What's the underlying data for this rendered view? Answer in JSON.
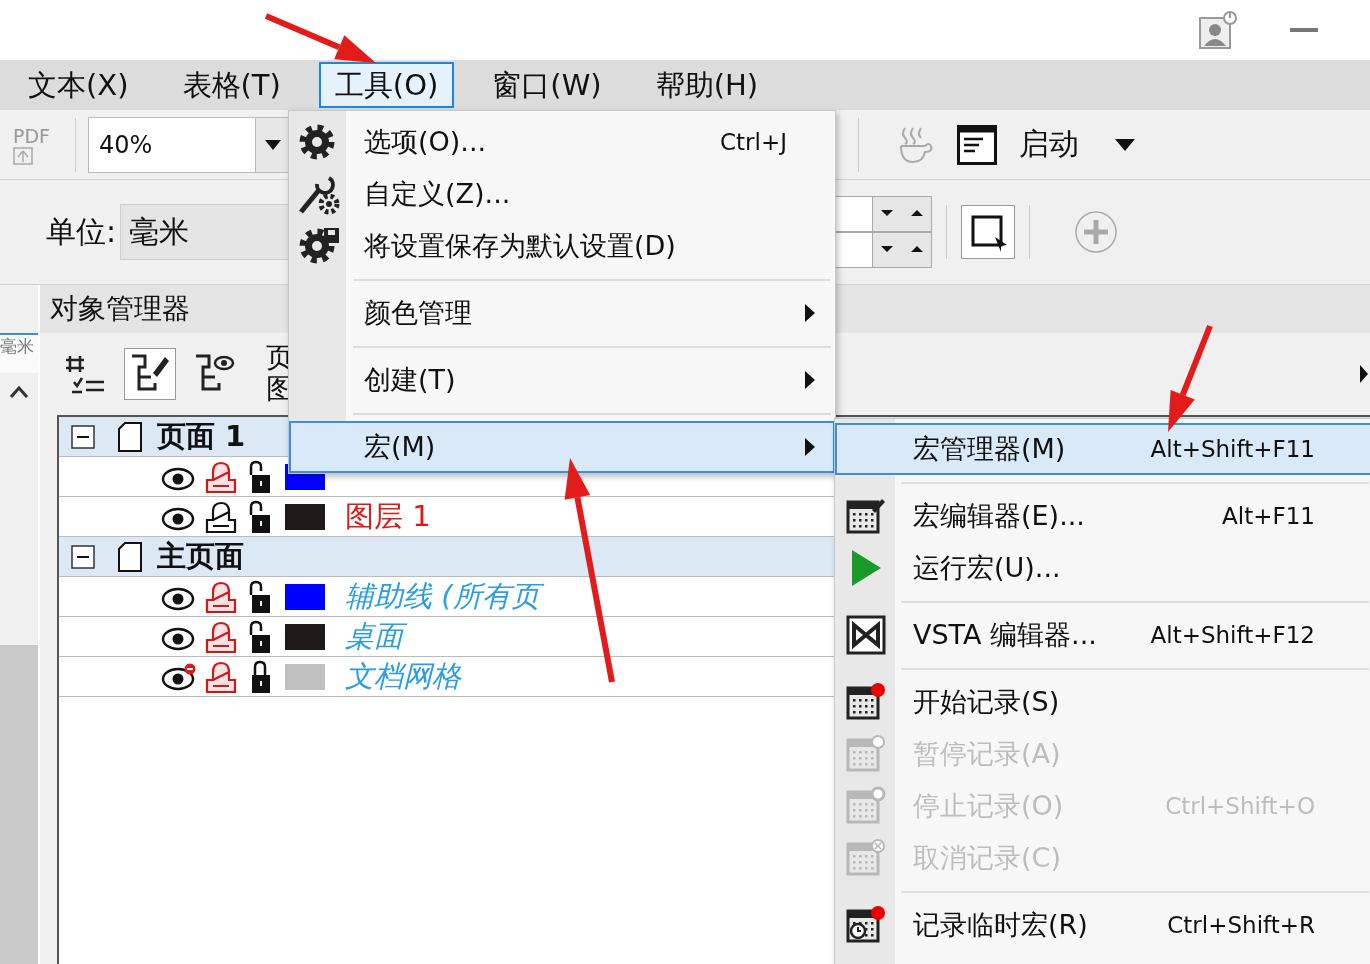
{
  "menu_bar": [
    {
      "label": "文本(X)",
      "selected": false
    },
    {
      "label": "表格(T)",
      "selected": false
    },
    {
      "label": "工具(O)",
      "selected": true
    },
    {
      "label": "窗口(W)",
      "selected": false
    },
    {
      "label": "帮助(H)",
      "selected": false
    }
  ],
  "toolbar": {
    "pdf_label": "PDF",
    "zoom": "40%",
    "launch_label": "启动",
    "unit_label": "单位:",
    "unit_value": "毫米"
  },
  "ruler": {
    "unit": "毫米"
  },
  "object_manager": {
    "title": "对象管理器",
    "tool_buttons": [
      {
        "selected": false
      },
      {
        "selected": true
      },
      {
        "selected": false
      }
    ],
    "view_label": "页图",
    "tree": [
      {
        "name": "页面 1",
        "expanded": true,
        "children": [
          {
            "visible": true,
            "printable": true,
            "locked": false,
            "color": "#0000ff"
          },
          {
            "name": "图层 1",
            "kind": "layer",
            "visible": true,
            "printable": false,
            "locked": false,
            "color": "#1e1a1a",
            "active": true
          }
        ]
      },
      {
        "name": "主页面",
        "expanded": true,
        "children": [
          {
            "name": "辅助线 (所有页",
            "kind": "master",
            "visible": true,
            "printable": true,
            "locked": false,
            "color": "#0000ff",
            "active": false
          },
          {
            "name": "桌面",
            "kind": "master",
            "visible": true,
            "printable": true,
            "locked": false,
            "color": "#1e1a1a",
            "active": false
          },
          {
            "name": "文档网格",
            "kind": "master",
            "visible": false,
            "printable": true,
            "locked": true,
            "color": "#c0c0c0",
            "active": false
          }
        ]
      }
    ]
  },
  "tools_menu": [
    {
      "kind": "command",
      "label": "选项(O)...",
      "shortcut": "Ctrl+J",
      "selected": false
    },
    {
      "kind": "command",
      "label": "自定义(Z)...",
      "selected": false
    },
    {
      "kind": "command",
      "label": "将设置保存为默认设置(D)",
      "selected": false
    },
    {
      "kind": "separator"
    },
    {
      "kind": "submenu",
      "label": "颜色管理",
      "selected": false
    },
    {
      "kind": "separator"
    },
    {
      "kind": "submenu",
      "label": "创建(T)",
      "selected": false
    },
    {
      "kind": "separator"
    },
    {
      "kind": "submenu",
      "label": "宏(M)",
      "selected": true
    }
  ],
  "macro_menu": [
    {
      "kind": "command",
      "label": "宏管理器(M)",
      "shortcut": "Alt+Shift+F11",
      "selected": true,
      "disabled": false
    },
    {
      "kind": "separator"
    },
    {
      "kind": "command",
      "label": "宏编辑器(E)...",
      "shortcut": "Alt+F11",
      "selected": false,
      "disabled": false
    },
    {
      "kind": "command",
      "label": "运行宏(U)...",
      "selected": false,
      "disabled": false
    },
    {
      "kind": "separator"
    },
    {
      "kind": "command",
      "label": "VSTA 编辑器...",
      "shortcut": "Alt+Shift+F12",
      "selected": false,
      "disabled": false
    },
    {
      "kind": "separator"
    },
    {
      "kind": "command",
      "label": "开始记录(S)",
      "selected": false,
      "disabled": false
    },
    {
      "kind": "command",
      "label": "暂停记录(A)",
      "selected": false,
      "disabled": true
    },
    {
      "kind": "command",
      "label": "停止记录(O)",
      "shortcut": "Ctrl+Shift+O",
      "selected": false,
      "disabled": true
    },
    {
      "kind": "command",
      "label": "取消记录(C)",
      "selected": false,
      "disabled": true
    },
    {
      "kind": "separator"
    },
    {
      "kind": "command",
      "label": "记录临时宏(R)",
      "shortcut": "Ctrl+Shift+R",
      "selected": false,
      "disabled": false
    }
  ]
}
